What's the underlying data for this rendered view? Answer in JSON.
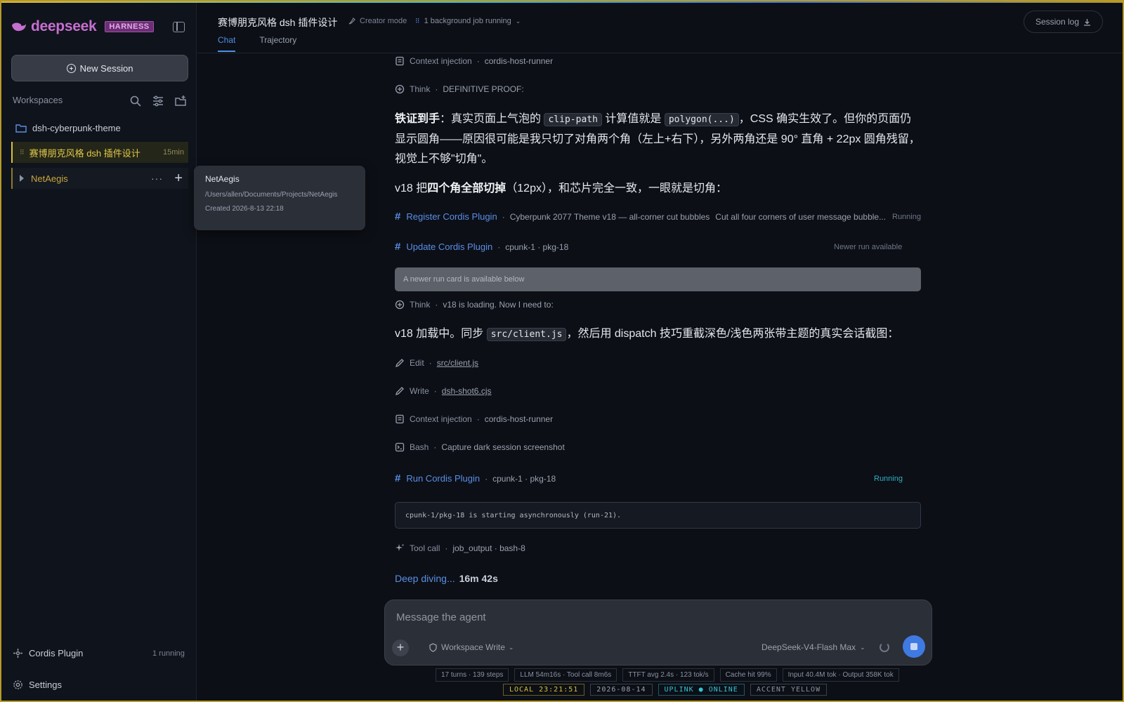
{
  "brand": {
    "name": "deepseek",
    "badge": "HARNESS"
  },
  "sidebar": {
    "new_session": "New Session",
    "workspaces_label": "Workspaces",
    "items": [
      {
        "label": "dsh-cyberpunk-theme"
      },
      {
        "label": "赛博朋克风格 dsh 插件设计",
        "time": "15min"
      },
      {
        "label": "NetAegis"
      }
    ],
    "cordis_label": "Cordis Plugin",
    "cordis_meta": "1 running",
    "settings_label": "Settings"
  },
  "tooltip": {
    "title": "NetAegis",
    "path": "/Users/allen/Documents/Projects/NetAegis",
    "created": "Created 2026-8-13 22:18"
  },
  "header": {
    "title": "赛博朋克风格 dsh 插件设计",
    "mode": "Creator mode",
    "job": "1 background job running",
    "tabs": [
      "Chat",
      "Trajectory"
    ],
    "session_log": "Session log"
  },
  "chat": {
    "ctx1": {
      "label": "Context injection",
      "value": "cordis-host-runner"
    },
    "think1": {
      "label": "Think",
      "value": "DEFINITIVE PROOF:"
    },
    "para1": {
      "bold": "铁证到手",
      "a": "：真实页面上气泡的",
      "code1": "clip-path",
      "b": "计算值就是",
      "code2": "polygon(...)",
      "c": "，CSS 确实生效了。但你的页面仍显示圆角——原因很可能是我只切了对角两个角（左上+右下），另外两角还是 90° 直角 + 22px 圆角残留，视觉上不够\"切角\"。"
    },
    "para2": {
      "a": "v18 把",
      "bold": "四个角全部切掉",
      "b": "（12px），和芯片完全一致，一眼就是切角："
    },
    "register": {
      "plugin": "Register Cordis Plugin",
      "value": "Cyberpunk 2077 Theme v18 — all-corner cut bubbles",
      "desc": "Cut all four corners of user message bubble...",
      "status": "Running"
    },
    "update": {
      "plugin": "Update Cordis Plugin",
      "value": "cpunk-1 · pkg-18",
      "status": "Newer run available"
    },
    "newer_card": "A newer run card is available below",
    "think2": {
      "label": "Think",
      "value": "v18 is loading. Now I need to:"
    },
    "para3": {
      "a": "v18 加载中。同步",
      "code": "src/client.js",
      "b": "，然后用 dispatch 技巧重截深色/浅色两张带主题的真实会话截图："
    },
    "edit": {
      "label": "Edit",
      "value": "src/client.js"
    },
    "write": {
      "label": "Write",
      "value": "dsh-shot6.cjs"
    },
    "ctx2": {
      "label": "Context injection",
      "value": "cordis-host-runner"
    },
    "bash": {
      "label": "Bash",
      "value": "Capture dark session screenshot"
    },
    "run": {
      "plugin": "Run Cordis Plugin",
      "value": "cpunk-1 · pkg-18",
      "status": "Running"
    },
    "run_output": "cpunk-1/pkg-18 is starting asynchronously (run-21).",
    "toolcall": {
      "label": "Tool call",
      "value": "job_output · bash-8"
    },
    "deep": "Deep diving...",
    "elapsed": "16m 42s"
  },
  "composer": {
    "placeholder": "Message the agent",
    "workspace": "Workspace Write",
    "model": "DeepSeek-V4-Flash Max"
  },
  "stats": [
    "17 turns · 139 steps",
    "LLM 54m16s · Tool call 8m6s",
    "TTFT avg 2.4s · 123 tok/s",
    "Cache hit 99%",
    "Input 40.4M tok · Output 358K tok"
  ],
  "hud": {
    "local": "LOCAL 23:21:51",
    "date": "2026-08-14",
    "uplink": "UPLINK ● ONLINE",
    "accent": "ACCENT YELLOW"
  },
  "colors": {
    "accent": "#d8c13a",
    "link": "#5a8fe6",
    "running": "#2fb0c4",
    "brand": "#c56fd0"
  }
}
